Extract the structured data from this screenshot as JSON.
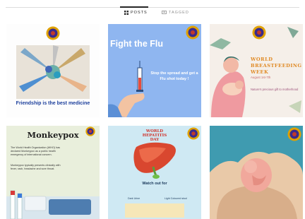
{
  "tabs": [
    {
      "label": "POSTS",
      "icon": "grid-icon",
      "active": true
    },
    {
      "label": "TAGGED",
      "icon": "tag-icon",
      "active": false
    }
  ],
  "posts": [
    {
      "caption": "Friendship is the best medicine"
    },
    {
      "title": "Fight the Flu",
      "message": "Stop the spread and get a Flu shot today !"
    },
    {
      "title": "WORLD BREASTFEEDING WEEK",
      "date": "August 1st-7th",
      "note": "Nature's precious gift to motherhood"
    },
    {
      "title": "Monkeypox",
      "para1": "The World Health Organization (WHO) has declared Monkeypox as a public health emergency of international concern.",
      "para2": "Monkeypox typically presents clinically with fever, rash, headache and sore throat."
    },
    {
      "title": "WORLD HEPATITIS DAY",
      "watch": "Watch out for",
      "symptom1": "Dark Urine",
      "symptom2": "Light Coloured stool"
    },
    {}
  ],
  "colors": {
    "badge_ring": "#e0a100",
    "badge_inner": "#3a2a8c",
    "flu_blue": "#8fb6f0"
  }
}
